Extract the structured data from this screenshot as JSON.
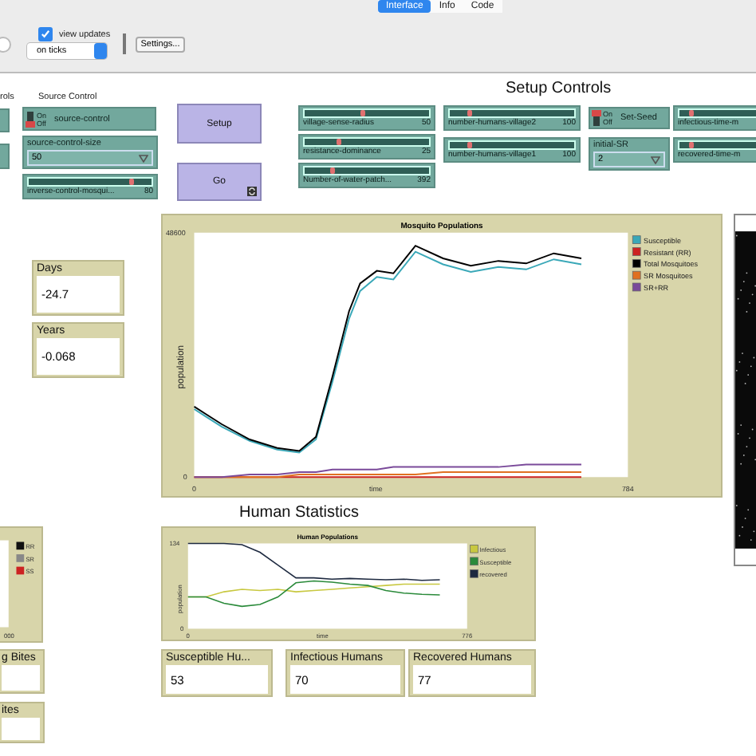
{
  "tabs": [
    {
      "label": "Interface",
      "selected": true
    },
    {
      "label": "Info",
      "selected": false
    },
    {
      "label": "Code",
      "selected": false
    }
  ],
  "toolbar": {
    "view_updates": {
      "label": "view updates",
      "checked": true
    },
    "update_mode": "on ticks",
    "settings_button": "Settings..."
  },
  "headings": [
    {
      "text": "rols",
      "kind": "small"
    },
    {
      "text": "Source Control",
      "kind": "small"
    },
    {
      "text": "Setup Controls",
      "kind": "large"
    },
    {
      "text": "Human Statistics",
      "kind": "large"
    }
  ],
  "widgets": [
    {
      "kind": "chooser"
    },
    {
      "kind": "chooser"
    },
    {
      "kind": "switch",
      "label": "source-control",
      "on_text": "On",
      "off_text": "Off",
      "on": false
    },
    {
      "kind": "chooser",
      "label": "source-control-size",
      "value": "50"
    },
    {
      "kind": "slider",
      "label": "inverse-control-mosqui...",
      "value": "80",
      "level": 0.82
    },
    {
      "kind": "button",
      "label": "Setup",
      "forever": false
    },
    {
      "kind": "button",
      "label": "Go",
      "forever": true
    },
    {
      "kind": "slider",
      "label": "village-sense-radius",
      "value": "50",
      "level": 0.45
    },
    {
      "kind": "slider",
      "label": "resistance-dominance",
      "value": "25",
      "level": 0.25
    },
    {
      "kind": "slider",
      "label": "Number-of-water-patch...",
      "value": "392",
      "level": 0.2
    },
    {
      "kind": "slider",
      "label": "number-humans-village2",
      "value": "100",
      "level": 0.14
    },
    {
      "kind": "slider",
      "label": "number-humans-village1",
      "value": "100",
      "level": 0.14
    },
    {
      "kind": "switch",
      "label": "Set-Seed",
      "on_text": "On",
      "off_text": "Off",
      "on": true
    },
    {
      "kind": "chooser",
      "label": "initial-SR",
      "value": "2"
    },
    {
      "kind": "slider",
      "label": "infectious-time-m",
      "level": 0.1
    },
    {
      "kind": "slider",
      "label": "recovered-time-m",
      "level": 0.1
    }
  ],
  "monitors": [
    {
      "label": "Days",
      "value": "-24.7"
    },
    {
      "label": "Years",
      "value": "-0.068"
    },
    {
      "label": "g Bites"
    },
    {
      "label": "Susceptible Hu...",
      "value": "53"
    },
    {
      "label": "Infectious Humans",
      "value": "70"
    },
    {
      "label": "Recovered Humans",
      "value": "77"
    },
    {
      "label": "ites"
    }
  ],
  "mosquito_plot": {
    "chart_data": {
      "type": "line",
      "legend": "right",
      "title": "Mosquito Populations",
      "xlabel": "time",
      "ylabel": "population",
      "xlim": [
        0,
        784
      ],
      "ylim": [
        0,
        48600
      ],
      "xticks": [
        0,
        784
      ],
      "yticks": [
        0,
        48600
      ],
      "x": [
        0,
        50,
        100,
        150,
        190,
        220,
        250,
        280,
        300,
        330,
        360,
        400,
        450,
        500,
        550,
        600,
        650,
        700
      ],
      "series": [
        {
          "name": "Susceptible",
          "color": "#3aa8b8",
          "values": [
            13500,
            10000,
            7200,
            5500,
            4900,
            7500,
            19000,
            31500,
            37000,
            39800,
            39300,
            44800,
            42300,
            40800,
            41800,
            41300,
            43300,
            42300
          ]
        },
        {
          "name": "Resistant (RR)",
          "color": "#cc2222",
          "values": [
            0,
            0,
            0,
            0,
            0,
            0,
            0,
            0,
            0,
            0,
            0,
            0,
            0,
            0,
            0,
            0,
            0,
            0
          ]
        },
        {
          "name": "Total Mosquitoes",
          "color": "#000000",
          "values": [
            14000,
            10500,
            7500,
            5800,
            5200,
            8000,
            20000,
            33000,
            38500,
            41000,
            40500,
            46000,
            43500,
            42000,
            43000,
            42500,
            44500,
            43500
          ]
        },
        {
          "name": "SR Mosquitoes",
          "color": "#e07020",
          "values": [
            0,
            0,
            0,
            0,
            500,
            500,
            500,
            500,
            500,
            500,
            500,
            500,
            1000,
            1000,
            1000,
            1000,
            1000,
            1000
          ]
        },
        {
          "name": "SR+RR",
          "color": "#7a4a9a",
          "values": [
            0,
            0,
            500,
            500,
            1000,
            1000,
            1500,
            1500,
            1500,
            1500,
            2000,
            2000,
            2000,
            2000,
            2000,
            2500,
            2500,
            2500
          ]
        }
      ]
    }
  },
  "human_plot": {
    "chart_data": {
      "type": "line",
      "legend": "right",
      "title": "Human Populations",
      "xlabel": "time",
      "ylabel": "population",
      "xlim": [
        0,
        776
      ],
      "ylim": [
        0,
        134
      ],
      "xticks": [
        0,
        776
      ],
      "yticks": [
        0,
        134
      ],
      "x": [
        0,
        50,
        100,
        150,
        200,
        250,
        300,
        350,
        400,
        450,
        500,
        550,
        600,
        650,
        700
      ],
      "series": [
        {
          "name": "Infectious",
          "color": "#c8c840",
          "values": [
            50,
            50,
            58,
            62,
            60,
            62,
            58,
            60,
            62,
            64,
            66,
            68,
            70,
            70,
            70
          ]
        },
        {
          "name": "Susceptible",
          "color": "#2a8a3a",
          "values": [
            50,
            50,
            40,
            35,
            38,
            50,
            72,
            75,
            73,
            70,
            68,
            60,
            56,
            54,
            53
          ]
        },
        {
          "name": "recovered",
          "color": "#1e2a40",
          "values": [
            134,
            134,
            134,
            132,
            120,
            100,
            80,
            80,
            78,
            79,
            78,
            77,
            78,
            76,
            77
          ]
        }
      ]
    }
  },
  "resistance_plot": {
    "legend": [
      {
        "label": "RR",
        "color": "#111111"
      },
      {
        "label": "SR",
        "color": "#888888"
      },
      {
        "label": "SS",
        "color": "#cc2222"
      }
    ],
    "x_tick": "000"
  }
}
